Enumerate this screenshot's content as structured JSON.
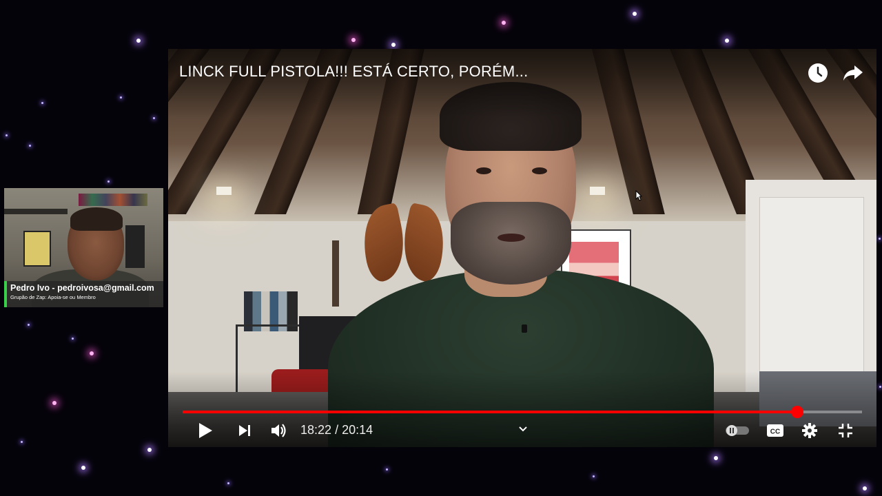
{
  "webcam": {
    "name_caption": "Pedro Ivo - pedroivosa@gmail.com",
    "sub_caption": "Grupão de Zap: Apoia-se ou Membro",
    "caption_accent": "#3ad14a"
  },
  "player": {
    "title": "LINCK FULL PISTOLA!!! ESTÁ CERTO, PORÉM...",
    "current_time": "18:22",
    "separator": "/",
    "duration": "20:14",
    "progress_fraction": 0.905,
    "progress_color": "#ff0000",
    "top_icons": [
      "watch-later-icon",
      "share-icon"
    ],
    "controls": [
      "play-icon",
      "next-icon",
      "volume-icon",
      "chevron-down-icon",
      "autoplay-toggle",
      "cc-icon",
      "gear-icon",
      "exit-fullscreen-icon"
    ]
  }
}
